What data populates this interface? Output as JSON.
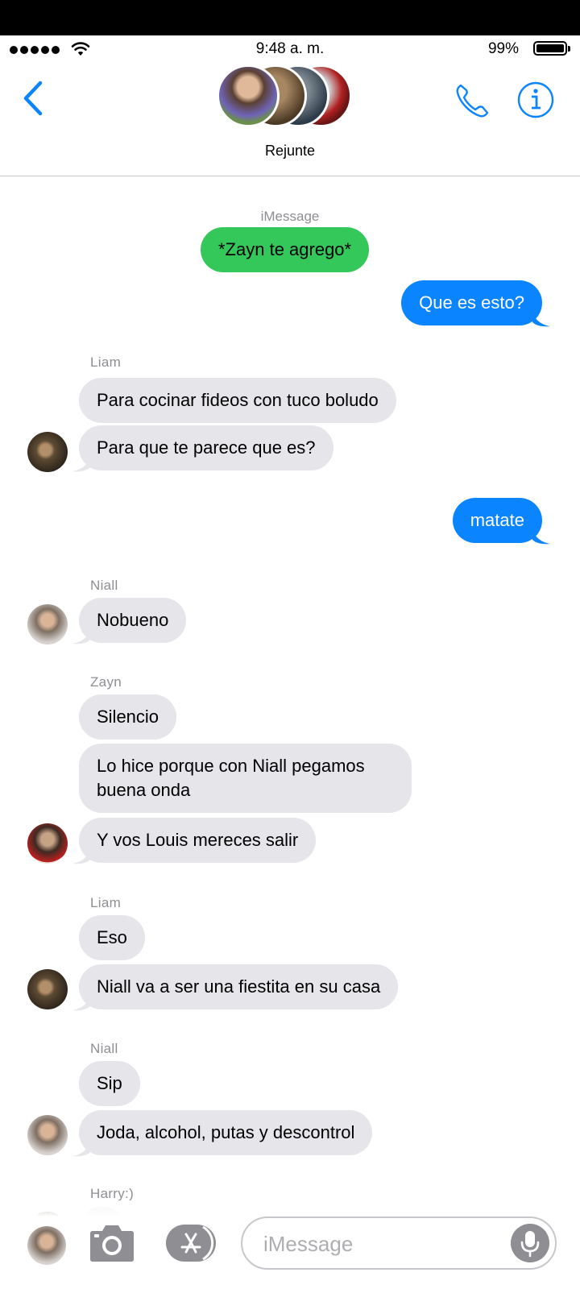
{
  "status_bar": {
    "time": "9:48 a. m.",
    "battery_percent": "99%",
    "battery_level": 0.99,
    "signal_dots": 5,
    "icons": [
      "signal-dots-icon",
      "wifi-icon",
      "battery-icon"
    ]
  },
  "header": {
    "group_name": "Rejunte",
    "icons": [
      "chevron-left-icon",
      "phone-icon",
      "info-icon"
    ],
    "participant_avatars": 4
  },
  "conversation": {
    "service_label": "iMessage",
    "items": [
      {
        "type": "outgoing",
        "text": "*Zayn te agrego*",
        "color": "#34c759"
      },
      {
        "type": "outgoing",
        "text": "Que es esto?",
        "color": "#0a84ff"
      },
      {
        "type": "sender",
        "text": "Liam"
      },
      {
        "type": "incoming",
        "text": "Para cocinar fideos con tuco boludo"
      },
      {
        "type": "incoming",
        "text": "Para que te parece que es?",
        "avatar": "liam"
      },
      {
        "type": "outgoing",
        "text": "matate",
        "color": "#0a84ff"
      },
      {
        "type": "sender",
        "text": "Niall"
      },
      {
        "type": "incoming",
        "text": "Nobueno",
        "avatar": "niall"
      },
      {
        "type": "sender",
        "text": "Zayn"
      },
      {
        "type": "incoming",
        "text": "Silencio"
      },
      {
        "type": "incoming",
        "text": "Lo hice porque con Niall pegamos buena onda"
      },
      {
        "type": "incoming",
        "text": "Y vos Louis mereces salir",
        "avatar": "zayn"
      },
      {
        "type": "sender",
        "text": "Liam"
      },
      {
        "type": "incoming",
        "text": "Eso"
      },
      {
        "type": "incoming",
        "text": "Niall va a ser una fiestita en su casa",
        "avatar": "liam"
      },
      {
        "type": "sender",
        "text": "Niall"
      },
      {
        "type": "incoming",
        "text": "Sip"
      },
      {
        "type": "incoming",
        "text": "Joda, alcohol, putas y descontrol",
        "avatar": "niall"
      },
      {
        "type": "sender",
        "text": "Harry:)"
      }
    ]
  },
  "composer": {
    "placeholder": "iMessage",
    "value": "",
    "icons": [
      "camera-icon",
      "app-store-icon",
      "microphone-icon"
    ]
  },
  "colors": {
    "accent": "#0a84ff",
    "incoming_bubble": "#e5e5ea",
    "green_bubble": "#34c759",
    "secondary_text": "#8e8e93"
  }
}
